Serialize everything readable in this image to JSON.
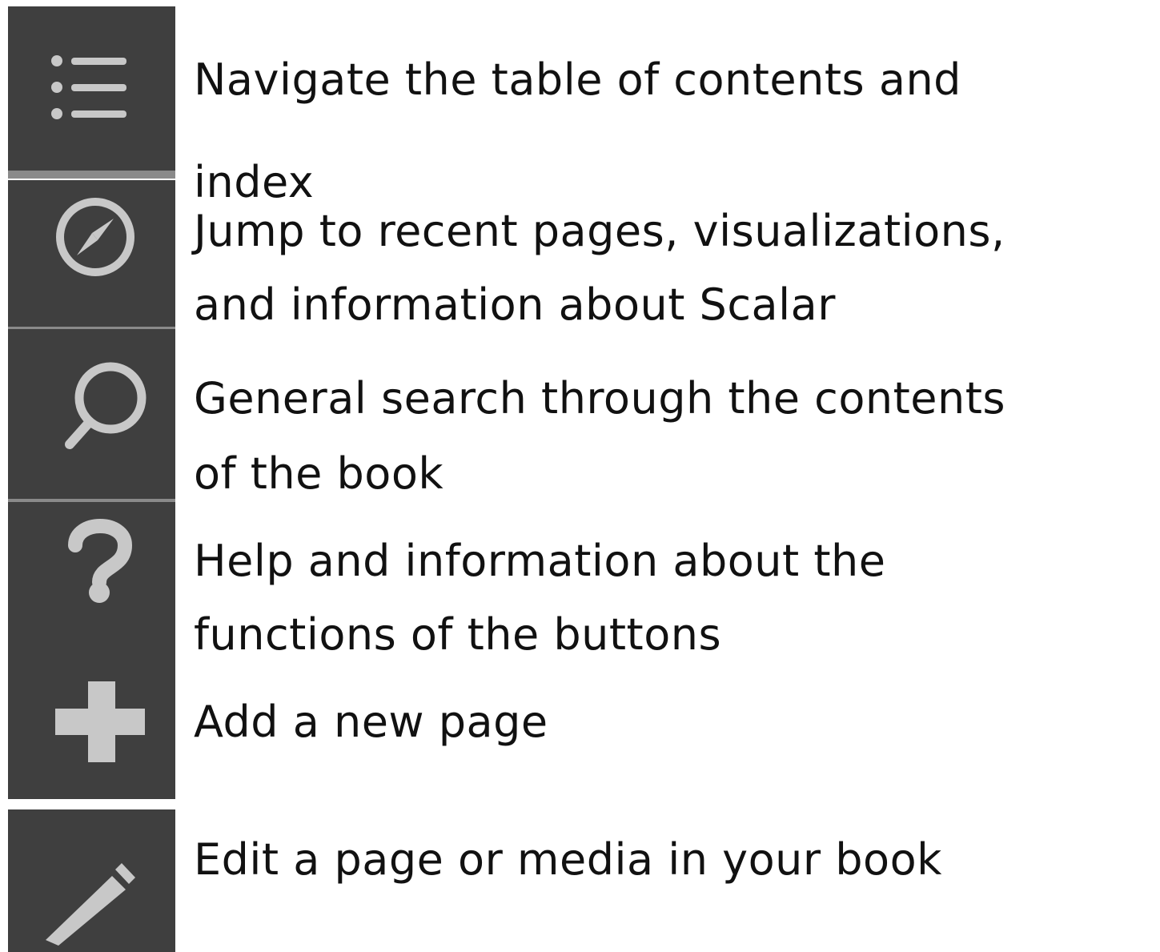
{
  "icon_color": "#c8c8c8",
  "button_background": "#3f3f3f",
  "items": [
    {
      "icon": "list-icon",
      "lines": [
        "Navigate the table of contents and",
        "index"
      ]
    },
    {
      "icon": "compass-icon",
      "lines": [
        "Jump to recent pages, visualizations,",
        "and information about Scalar"
      ]
    },
    {
      "icon": "search-icon",
      "lines": [
        "General search through the contents",
        "of the book"
      ]
    },
    {
      "icon": "help-icon",
      "lines": [
        "Help and information about the",
        "functions of the buttons"
      ]
    },
    {
      "icon": "plus-icon",
      "lines": [
        "Add a new page"
      ]
    },
    {
      "icon": "pencil-icon",
      "lines": [
        "Edit a page or media in your book"
      ]
    }
  ]
}
